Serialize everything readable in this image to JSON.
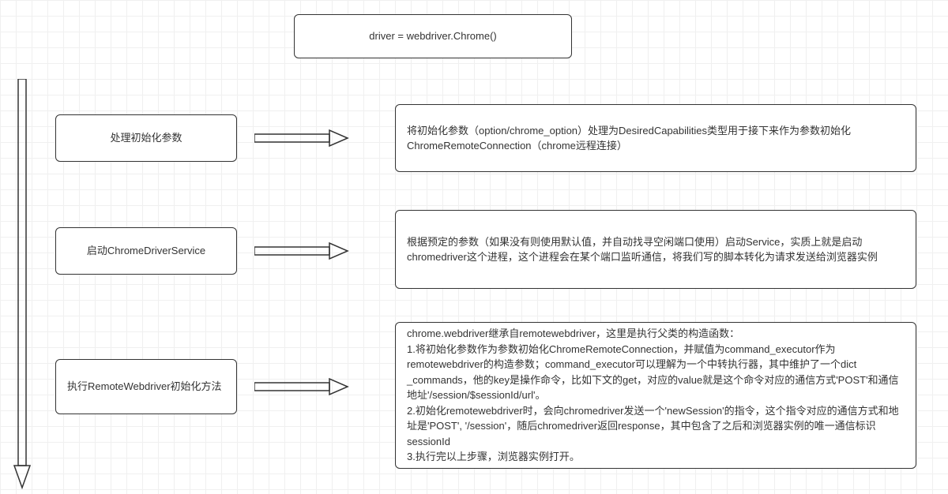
{
  "title": "driver = webdriver.Chrome()",
  "steps": [
    {
      "label": "处理初始化参数",
      "desc": "将初始化参数（option/chrome_option）处理为DesiredCapabilities类型用于接下来作为参数初始化ChromeRemoteConnection（chrome远程连接）"
    },
    {
      "label": "启动ChromeDriverService",
      "desc": "根据预定的参数（如果没有则使用默认值，并自动找寻空闲端口使用）启动Service，实质上就是启动chromedriver这个进程，这个进程会在某个端口监听通信，将我们写的脚本转化为请求发送给浏览器实例"
    },
    {
      "label": "执行RemoteWebdriver初始化方法",
      "desc": "chrome.webdriver继承自remotewebdriver，这里是执行父类的构造函数：\n1.将初始化参数作为参数初始化ChromeRemoteConnection，并赋值为command_executor作为remotewebdriver的构造参数；command_executor可以理解为一个中转执行器，其中维护了一个dict _commands，他的key是操作命令，比如下文的get，对应的value就是这个命令对应的通信方式'POST'和通信地址'/session/$sessionId/url'。\n2.初始化remotewebdriver时，会向chromedriver发送一个'newSession'的指令，这个指令对应的通信方式和地址是'POST', '/session'，随后chromedriver返回response，其中包含了之后和浏览器实例的唯一通信标识sessionId\n3.执行完以上步骤，浏览器实例打开。"
    }
  ]
}
